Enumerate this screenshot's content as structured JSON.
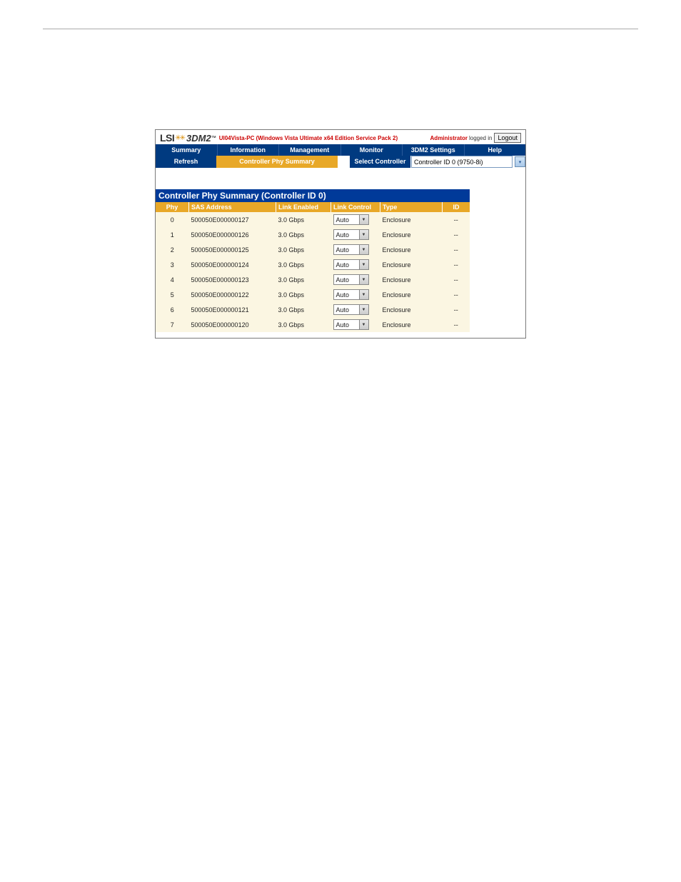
{
  "header": {
    "logo_lsi": "LSI",
    "logo_3dm2": "3DM2",
    "logo_tm": "™",
    "host_string": "Ul04Vista-PC (Windows Vista Ultimate x64 Edition Service Pack 2)",
    "admin_label": "Administrator",
    "logged_in_text": "logged in",
    "logout_label": "Logout"
  },
  "nav": {
    "items": [
      "Summary",
      "Information",
      "Management",
      "Monitor",
      "3DM2 Settings",
      "Help"
    ]
  },
  "subbar": {
    "refresh": "Refresh",
    "page_title": "Controller Phy Summary",
    "select_label": "Select Controller",
    "select_value": "Controller ID 0 (9750-8i)"
  },
  "panel": {
    "title": "Controller Phy Summary (Controller ID 0)",
    "columns": {
      "phy": "Phy",
      "sas": "SAS Address",
      "link_enabled": "Link Enabled",
      "link_control": "Link Control",
      "type": "Type",
      "id": "ID"
    },
    "rows": [
      {
        "phy": "0",
        "sas": "500050E000000127",
        "link": "3.0 Gbps",
        "ctrl": "Auto",
        "type": "Enclosure",
        "id": "--"
      },
      {
        "phy": "1",
        "sas": "500050E000000126",
        "link": "3.0 Gbps",
        "ctrl": "Auto",
        "type": "Enclosure",
        "id": "--"
      },
      {
        "phy": "2",
        "sas": "500050E000000125",
        "link": "3.0 Gbps",
        "ctrl": "Auto",
        "type": "Enclosure",
        "id": "--"
      },
      {
        "phy": "3",
        "sas": "500050E000000124",
        "link": "3.0 Gbps",
        "ctrl": "Auto",
        "type": "Enclosure",
        "id": "--"
      },
      {
        "phy": "4",
        "sas": "500050E000000123",
        "link": "3.0 Gbps",
        "ctrl": "Auto",
        "type": "Enclosure",
        "id": "--"
      },
      {
        "phy": "5",
        "sas": "500050E000000122",
        "link": "3.0 Gbps",
        "ctrl": "Auto",
        "type": "Enclosure",
        "id": "--"
      },
      {
        "phy": "6",
        "sas": "500050E000000121",
        "link": "3.0 Gbps",
        "ctrl": "Auto",
        "type": "Enclosure",
        "id": "--"
      },
      {
        "phy": "7",
        "sas": "500050E000000120",
        "link": "3.0 Gbps",
        "ctrl": "Auto",
        "type": "Enclosure",
        "id": "--"
      }
    ]
  }
}
